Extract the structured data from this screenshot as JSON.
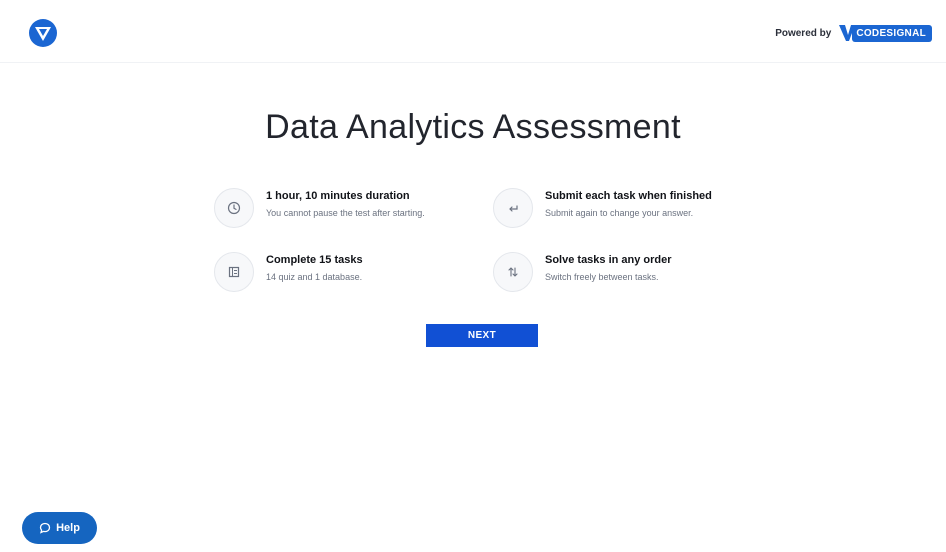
{
  "header": {
    "logo_icon": "brand-shield-icon",
    "powered_by_label": "Powered by",
    "codesignal_logo_text": "CODESIGNAL"
  },
  "main": {
    "title": "Data Analytics Assessment",
    "features": [
      {
        "icon": "clock-icon",
        "title": "1 hour, 10 minutes duration",
        "description": "You cannot pause the test after starting."
      },
      {
        "icon": "return-arrow-icon",
        "title": "Submit each task when finished",
        "description": "Submit again to change your answer."
      },
      {
        "icon": "task-list-icon",
        "title": "Complete 15 tasks",
        "description": "14 quiz and 1 database."
      },
      {
        "icon": "switch-arrows-icon",
        "title": "Solve tasks in any order",
        "description": "Switch freely between tasks."
      }
    ],
    "next_label": "NEXT"
  },
  "help": {
    "label": "Help",
    "icon": "chat-bubble-icon"
  },
  "colors": {
    "primary": "#1150d4",
    "help": "#1565c0",
    "brand": "#1b66d2"
  }
}
